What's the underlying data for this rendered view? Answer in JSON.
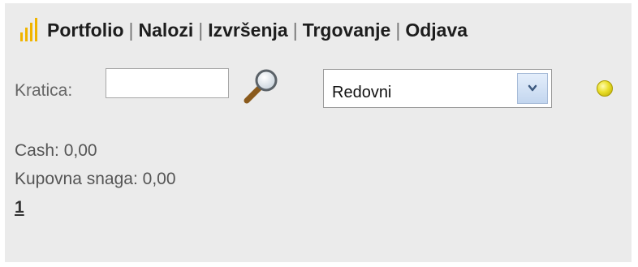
{
  "nav": {
    "logo_icon": "bar-chart-logo-icon",
    "items": [
      {
        "label": "Portfolio"
      },
      {
        "label": "Nalozi"
      },
      {
        "label": "Izvršenja"
      },
      {
        "label": "Trgovanje"
      },
      {
        "label": "Odjava"
      }
    ],
    "separator": "|"
  },
  "search": {
    "label": "Kratica:",
    "value": "",
    "icon": "magnifier-icon"
  },
  "order_type_select": {
    "selected": "Redovni"
  },
  "status": {
    "indicator_color": "#eadf2a"
  },
  "account": {
    "cash_label": "Cash:",
    "cash_value": "0,00",
    "buying_power_label": "Kupovna snaga:",
    "buying_power_value": "0,00"
  },
  "pagination": {
    "current_page": "1"
  }
}
